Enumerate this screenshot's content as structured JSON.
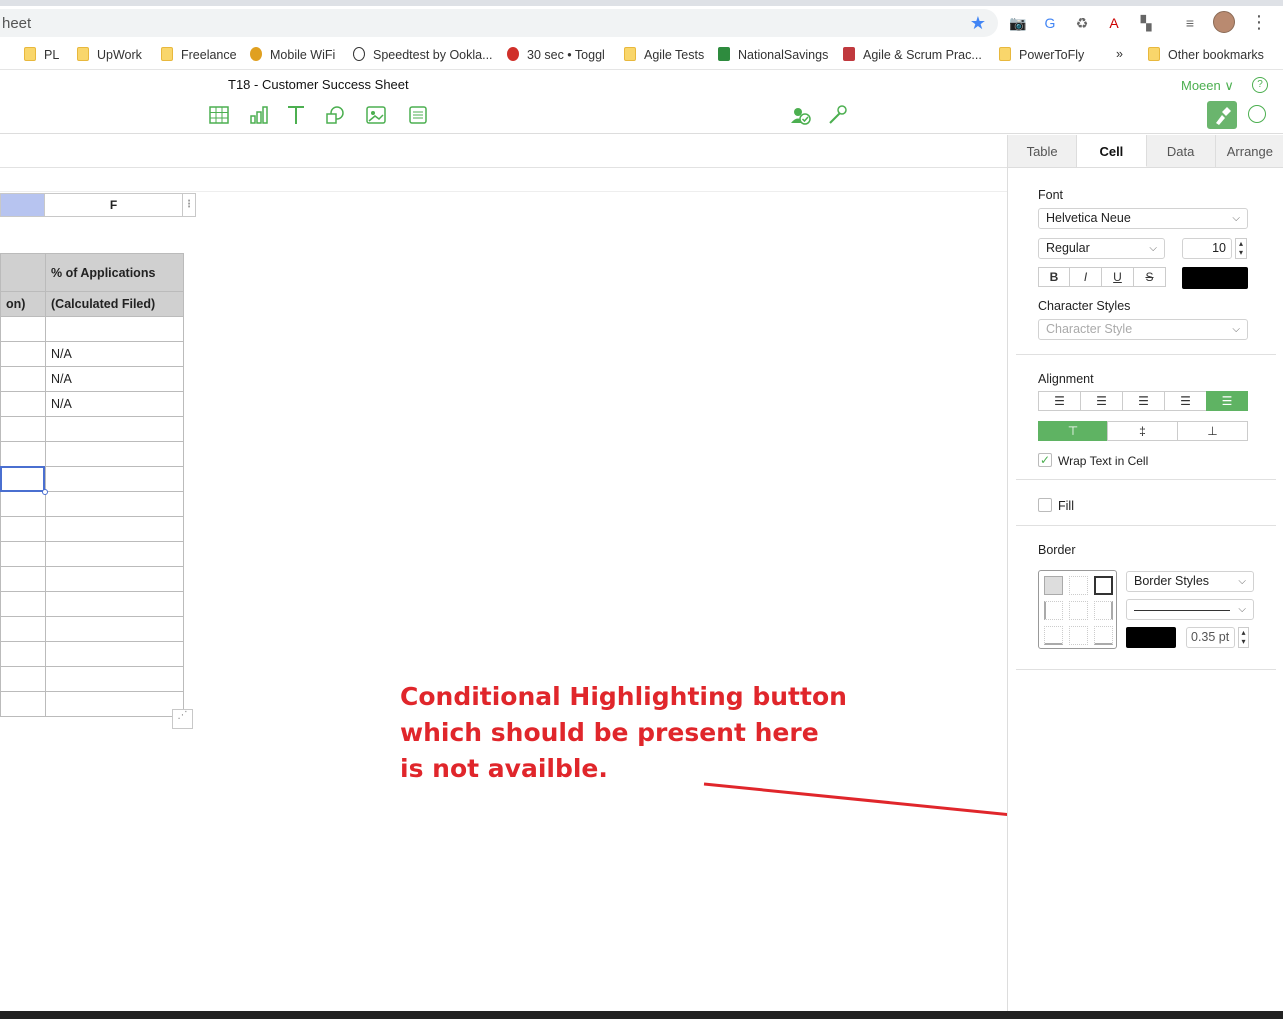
{
  "browser": {
    "url_text": "heet",
    "bookmarks": [
      {
        "label": "PL"
      },
      {
        "label": "UpWork"
      },
      {
        "label": "Freelance"
      },
      {
        "label": "Mobile WiFi"
      },
      {
        "label": "Speedtest by Ookla..."
      },
      {
        "label": "30 sec • Toggl"
      },
      {
        "label": "Agile Tests"
      },
      {
        "label": "NationalSavings"
      },
      {
        "label": "Agile & Scrum Prac..."
      },
      {
        "label": "PowerToFly"
      }
    ],
    "bookmarks_overflow": "»",
    "other_bookmarks": "Other bookmarks"
  },
  "app": {
    "doc_title": "T18 - Customer Success Sheet",
    "user_name": "Moeen",
    "user_chevron": "∨",
    "help": "?"
  },
  "sheet": {
    "column_f_header": "F",
    "header_row1": [
      "",
      "% of Applications"
    ],
    "header_row2": [
      "on)",
      "(Calculated Filed)"
    ],
    "rows": [
      [
        "",
        ""
      ],
      [
        "",
        "N/A"
      ],
      [
        "",
        "N/A"
      ],
      [
        "",
        "N/A"
      ],
      [
        "",
        ""
      ],
      [
        "",
        ""
      ],
      [
        "",
        ""
      ],
      [
        "",
        ""
      ],
      [
        "",
        ""
      ],
      [
        "",
        ""
      ],
      [
        "",
        ""
      ],
      [
        "",
        ""
      ],
      [
        "",
        ""
      ],
      [
        "",
        ""
      ],
      [
        "",
        ""
      ],
      [
        "",
        ""
      ]
    ]
  },
  "annotation": {
    "line1": "Conditional Highlighting button",
    "line2": "which should be present here",
    "line3": "is not availble."
  },
  "sidebar": {
    "tabs": [
      "Table",
      "Cell",
      "Data",
      "Arrange"
    ],
    "active_tab": "Cell",
    "font_label": "Font",
    "font_family": "Helvetica Neue",
    "font_weight": "Regular",
    "font_size": "10",
    "bold": "B",
    "italic": "I",
    "underline": "U",
    "strike": "S",
    "text_color": "#000000",
    "char_styles_label": "Character Styles",
    "char_style_placeholder": "Character Style",
    "alignment_label": "Alignment",
    "wrap_text_label": "Wrap Text in Cell",
    "wrap_text_checked": true,
    "fill_label": "Fill",
    "border_label": "Border",
    "border_styles": "Border Styles",
    "border_width": "0.35 pt",
    "border_color": "#000000",
    "accent": "#5fb363"
  }
}
